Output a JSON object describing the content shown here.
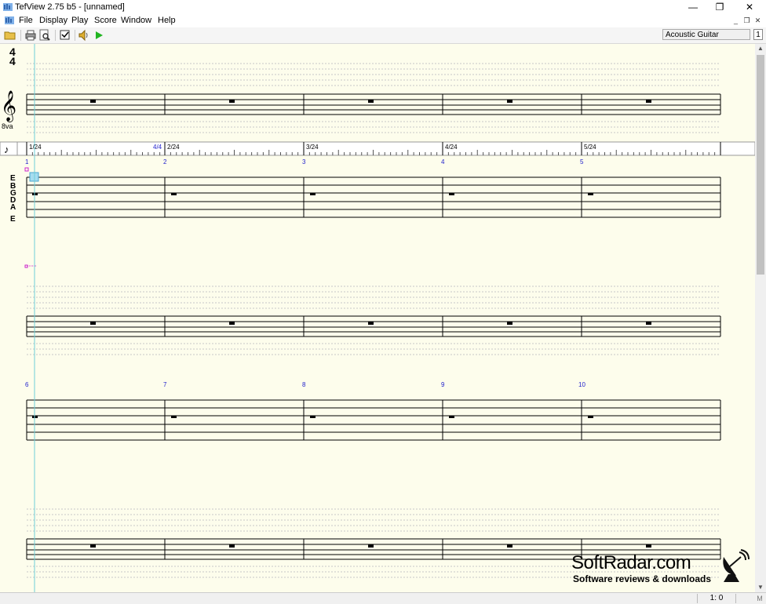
{
  "window": {
    "title": "TefView 2.75 b5  - [unnamed]"
  },
  "menu": [
    "File",
    "Display",
    "Play",
    "Score",
    "Window",
    "Help"
  ],
  "toolbar": {
    "instrument": "Acoustic Guitar",
    "track_number": "1"
  },
  "score": {
    "time_signature": {
      "top": "4",
      "bottom": "4"
    },
    "octave_mark": "8va",
    "beat_labels": [
      "1/24",
      "2/24",
      "3/24",
      "4/24",
      "5/24"
    ],
    "meter_label": "4/4",
    "tab_strings": [
      "E",
      "B",
      "G",
      "D",
      "A",
      "E"
    ],
    "system_1_measures": [
      "1",
      "2",
      "3",
      "4",
      "5"
    ],
    "system_2_measures": [
      "6",
      "7",
      "8",
      "9",
      "10"
    ]
  },
  "status": {
    "position": "1: 0",
    "mode": "M"
  },
  "watermark": {
    "title": "SoftRadar.com",
    "subtitle": "Software reviews & downloads"
  }
}
